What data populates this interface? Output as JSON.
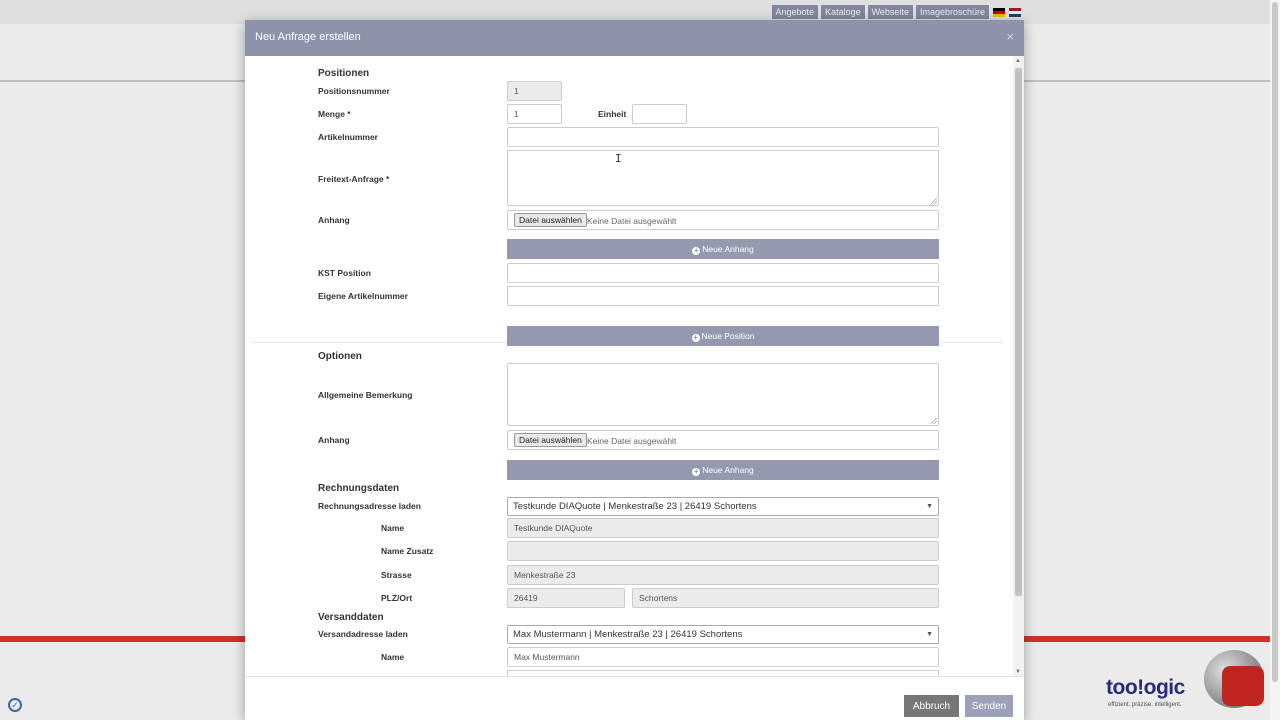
{
  "nav": {
    "items": [
      "Angebote",
      "Kataloge",
      "Webseite",
      "Imagebroschüre"
    ],
    "flags": [
      "de-flag-icon",
      "nl-flag-icon"
    ]
  },
  "brand": {
    "logo": "too!ogic",
    "tagline": "effizient. präzise. intelligent."
  },
  "modal": {
    "title": "Neu Anfrage erstellen",
    "close": "×",
    "cancel_label": "Abbruch",
    "send_label": "Senden"
  },
  "positionen": {
    "heading": "Positionen",
    "positionsnummer_label": "Positionsnummer",
    "positionsnummer_value": "1",
    "menge_label": "Menge *",
    "menge_value": "1",
    "einheit_label": "Einheit",
    "einheit_value": "",
    "artikelnummer_label": "Artikelnummer",
    "freitext_label": "Freitext-Anfrage *",
    "anhang_label": "Anhang",
    "file_button": "Datei auswählen",
    "file_status": "Keine Datei ausgewählt",
    "neue_anhang": "Neue Anhang",
    "kst_label": "KST Position",
    "eigene_label": "Eigene Artikelnummer",
    "neue_position": "Neue Position"
  },
  "optionen": {
    "heading": "Optionen",
    "bemerkung_label": "Allgemeine Bemerkung",
    "anhang_label": "Anhang",
    "file_button": "Datei auswählen",
    "file_status": "Keine Datei ausgewählt",
    "neue_anhang": "Neue Anhang"
  },
  "rechnung": {
    "heading": "Rechnungsdaten",
    "laden_label": "Rechnungsadresse laden",
    "selected": "Testkunde DIAQuote | Menkestraße 23 | 26419 Schortens",
    "name_label": "Name",
    "name_value": "Testkunde DIAQuote",
    "zusatz_label": "Name Zusatz",
    "zusatz_value": "",
    "strasse_label": "Strasse",
    "strasse_value": "Menkestraße 23",
    "plzort_label": "PLZ/Ort",
    "plz_value": "26419",
    "ort_value": "Schortens"
  },
  "versand": {
    "heading": "Versanddaten",
    "laden_label": "Versandadresse laden",
    "selected": "Max Mustermann | Menkestraße 23 | 26419 Schortens",
    "name_label": "Name",
    "name_value": "Max Mustermann"
  }
}
